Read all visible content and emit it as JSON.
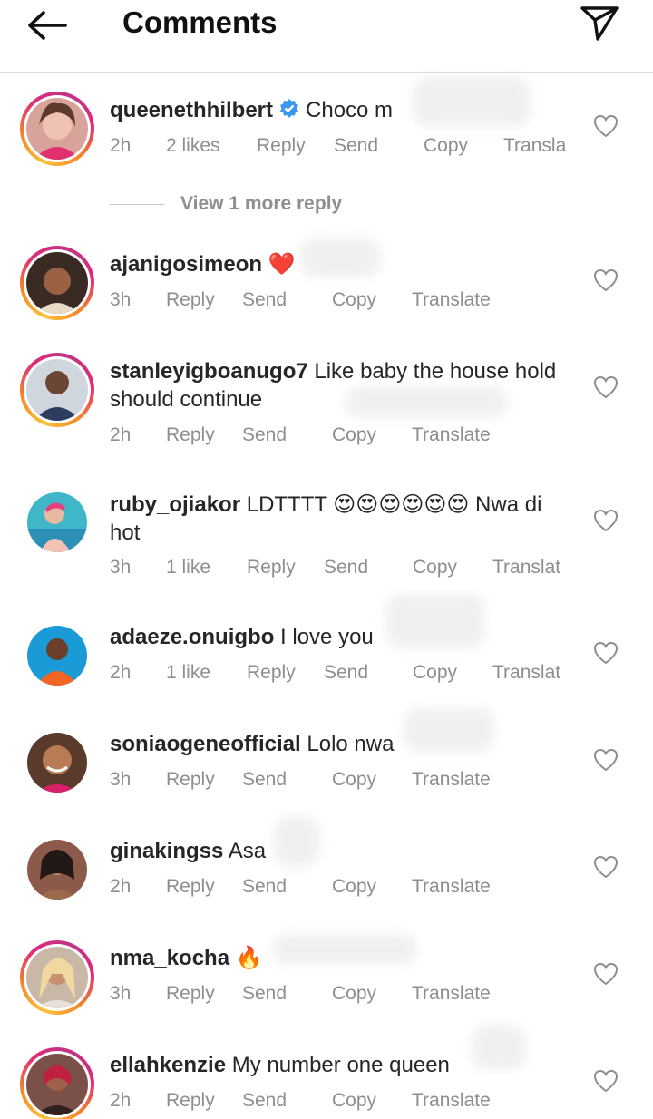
{
  "header": {
    "title": "Comments",
    "back_icon": "arrow-left-icon",
    "send_icon": "paper-plane-icon"
  },
  "comments": [
    {
      "username": "queenethhilbert",
      "verified": true,
      "text": "Choco m",
      "time": "2h",
      "likes": "2 likes",
      "reply": "Reply",
      "send": "Send",
      "copy": "Copy",
      "translate": "Transla",
      "view_more": "View 1 more reply",
      "story_ring": true
    },
    {
      "username": "ajanigosimeon",
      "text": "❤️",
      "time": "3h",
      "reply": "Reply",
      "send": "Send",
      "copy": "Copy",
      "translate": "Translate",
      "story_ring": true
    },
    {
      "username": "stanleyigboanugo7",
      "text": "Like baby the house hold should continue",
      "time": "2h",
      "reply": "Reply",
      "send": "Send",
      "copy": "Copy",
      "translate": "Translate",
      "story_ring": true
    },
    {
      "username": "ruby_ojiakor",
      "text": "LDTTTT 😍😍😍😍😍😍 Nwa di hot",
      "time": "3h",
      "likes": "1 like",
      "reply": "Reply",
      "send": "Send",
      "copy": "Copy",
      "translate": "Translat",
      "story_ring": false
    },
    {
      "username": "adaeze.onuigbo",
      "text": "I love you",
      "time": "2h",
      "likes": "1 like",
      "reply": "Reply",
      "send": "Send",
      "copy": "Copy",
      "translate": "Translat",
      "story_ring": false
    },
    {
      "username": "soniaogeneofficial",
      "text": "Lolo nwa",
      "time": "3h",
      "reply": "Reply",
      "send": "Send",
      "copy": "Copy",
      "translate": "Translate",
      "story_ring": false
    },
    {
      "username": "ginakingss",
      "text": "Asa",
      "time": "2h",
      "reply": "Reply",
      "send": "Send",
      "copy": "Copy",
      "translate": "Translate",
      "story_ring": false
    },
    {
      "username": "nma_kocha",
      "text": "🔥",
      "time": "3h",
      "reply": "Reply",
      "send": "Send",
      "copy": "Copy",
      "translate": "Translate",
      "story_ring": true
    },
    {
      "username": "ellahkenzie",
      "text": "My number one queen",
      "time": "2h",
      "reply": "Reply",
      "send": "Send",
      "copy": "Copy",
      "translate": "Translate",
      "story_ring": true
    }
  ],
  "colors": {
    "meta": "#8e8e8e",
    "verified": "#3897f0",
    "text": "#262626"
  }
}
